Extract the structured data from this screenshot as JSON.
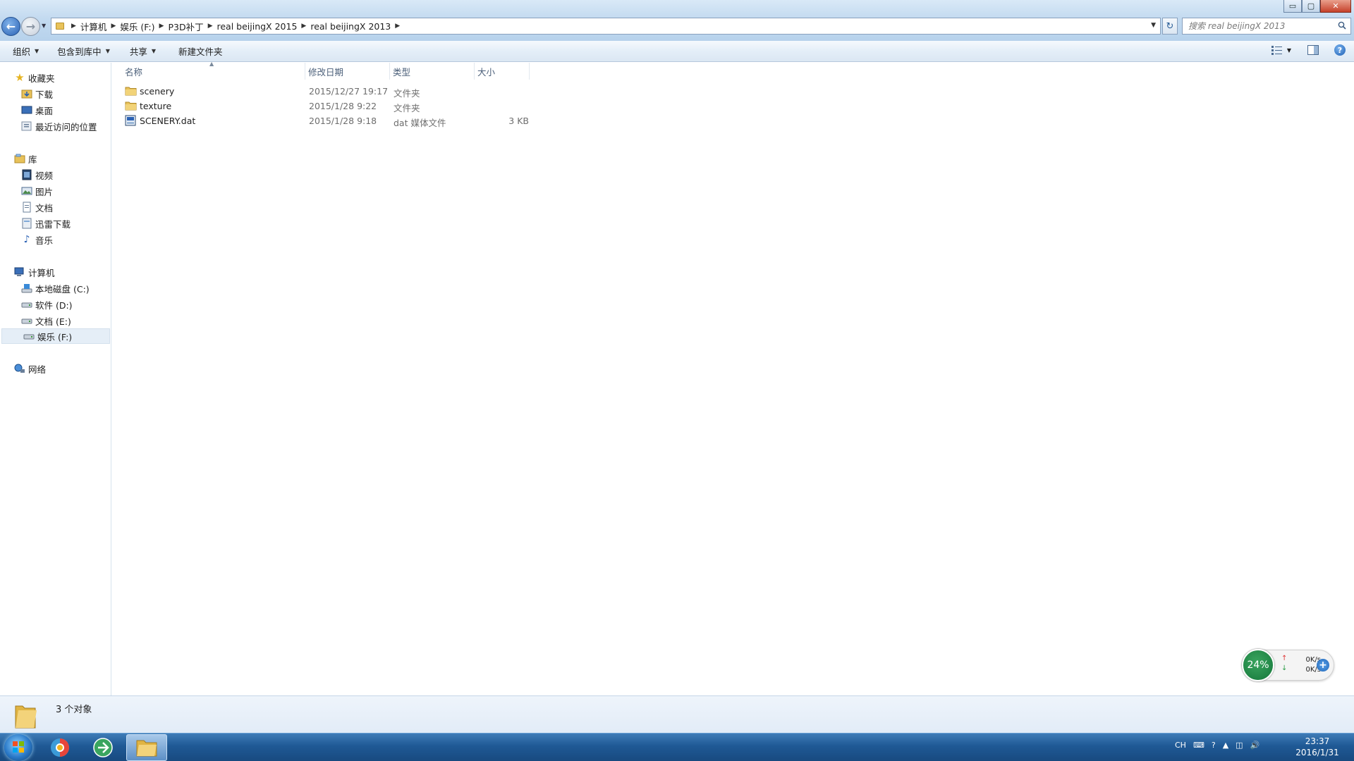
{
  "window": {
    "minimize": "▭",
    "maximize": "▢",
    "close": "✕"
  },
  "address": {
    "crumbs": [
      "计算机",
      "娱乐 (F:)",
      "P3D补丁",
      "real beijingX 2015",
      "real beijingX 2013"
    ]
  },
  "search": {
    "placeholder": "搜索 real beijingX 2013"
  },
  "toolbar": {
    "organize": "组织",
    "include_library": "包含到库中",
    "share": "共享",
    "new_folder": "新建文件夹"
  },
  "nav": {
    "favorites": "收藏夹",
    "downloads": "下载",
    "desktop": "桌面",
    "recent": "最近访问的位置",
    "libraries": "库",
    "videos": "视频",
    "pictures": "图片",
    "documents": "文档",
    "thunder": "迅雷下载",
    "music": "音乐",
    "computer": "计算机",
    "drive_c": "本地磁盘 (C:)",
    "drive_d": "软件 (D:)",
    "drive_e": "文档 (E:)",
    "drive_f": "娱乐 (F:)",
    "network": "网络"
  },
  "columns": {
    "name": "名称",
    "date": "修改日期",
    "type": "类型",
    "size": "大小"
  },
  "files": [
    {
      "name": "scenery",
      "date": "2015/12/27 19:17",
      "type": "文件夹",
      "size": "",
      "icon": "folder-icon"
    },
    {
      "name": "texture",
      "date": "2015/1/28 9:22",
      "type": "文件夹",
      "size": "",
      "icon": "folder-icon"
    },
    {
      "name": "SCENERY.dat",
      "date": "2015/1/28 9:18",
      "type": "dat 媒体文件",
      "size": "3 KB",
      "icon": "media-file-icon"
    }
  ],
  "status": {
    "count": "3 个对象"
  },
  "netwidget": {
    "percent": "24%",
    "up": "0K/s",
    "down": "0K/s"
  },
  "taskbar": {
    "tray_lang": "CH",
    "time": "23:37",
    "date": "2016/1/31"
  },
  "colors": {
    "accent": "#2b62b4",
    "selection": "#e5eef7",
    "taskbar": "#1f5995",
    "net_green": "#15763a"
  }
}
